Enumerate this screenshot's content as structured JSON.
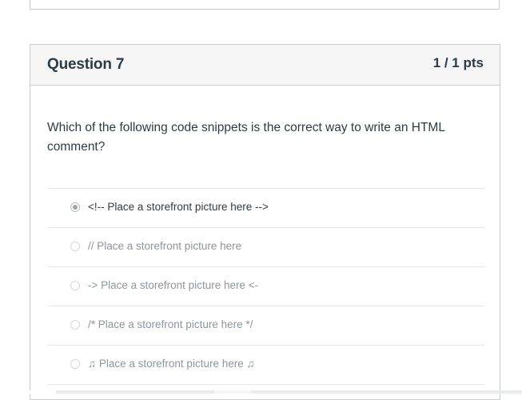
{
  "question": {
    "title": "Question 7",
    "points": "1 / 1 pts",
    "text": "Which of the following code snippets is the correct way to write an HTML comment?"
  },
  "answers": [
    {
      "label": "<!-- Place a storefront picture here -->",
      "selected": true
    },
    {
      "label": "// Place a storefront picture here",
      "selected": false
    },
    {
      "label": "-> Place a storefront picture here <-",
      "selected": false
    },
    {
      "label": "/* Place a storefront picture here */",
      "selected": false
    },
    {
      "label": "♫ Place a storefront picture here ♫",
      "selected": false
    }
  ],
  "colors": {
    "text": "#2d3b45",
    "muted_text": "#8b969e",
    "header_bg": "#f5f5f5",
    "border": "#c7cdd1"
  }
}
